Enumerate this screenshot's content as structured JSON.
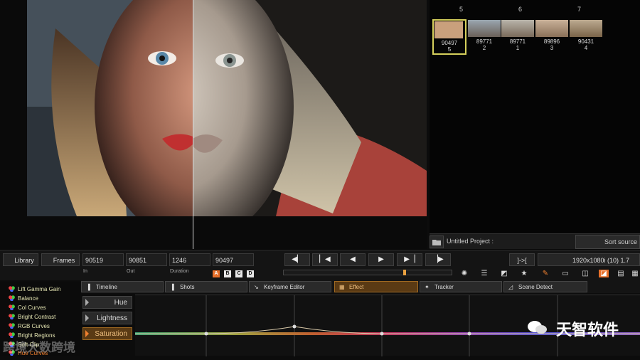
{
  "rack": {
    "indices": [
      "5",
      "6",
      "7"
    ],
    "thumbs": [
      {
        "frame": "90497",
        "num": "5",
        "selected": true,
        "tone": "#c9a07c"
      },
      {
        "frame": "89771",
        "num": "2",
        "selected": false,
        "tone": "#8a8070"
      },
      {
        "frame": "89771",
        "num": "1",
        "selected": false,
        "tone": "#9a8a78"
      },
      {
        "frame": "89896",
        "num": "3",
        "selected": false,
        "tone": "#b0967c"
      },
      {
        "frame": "90431",
        "num": "4",
        "selected": false,
        "tone": "#a08868"
      }
    ]
  },
  "project": {
    "name": "Untitled Project :",
    "sort_label": "Sort source"
  },
  "controls": {
    "library_label": "Library",
    "frames_label": "Frames",
    "in_value": "90519",
    "out_value": "90851",
    "duration_value": "1246",
    "current_value": "90497",
    "in_label": "In",
    "out_label": "Out",
    "duration_label": "Duration",
    "versions": [
      "A",
      "B",
      "C",
      "D"
    ],
    "snap_label": "]->[",
    "format_label": "1920x1080i (10) 1.7"
  },
  "effects": [
    "Lift Gamma Gain",
    "Balance",
    "Col Curves",
    "Bright Contrast",
    "RGB Curves",
    "Bright Regions",
    "Soft Clip",
    "Hue Curves"
  ],
  "tabs": [
    "Timeline",
    "Shots",
    "Keyframe Editor",
    "Effect",
    "Tracker",
    "Scene Detect"
  ],
  "active_tab": "Effect",
  "curve_channels": [
    "Hue",
    "Lightness",
    "Saturation"
  ],
  "active_channel": "Saturation",
  "watermarks": {
    "left": "跨境大数跨境",
    "right": "天智软件"
  },
  "colors": {
    "accent": "#f08030",
    "selection": "#d6d05c"
  }
}
